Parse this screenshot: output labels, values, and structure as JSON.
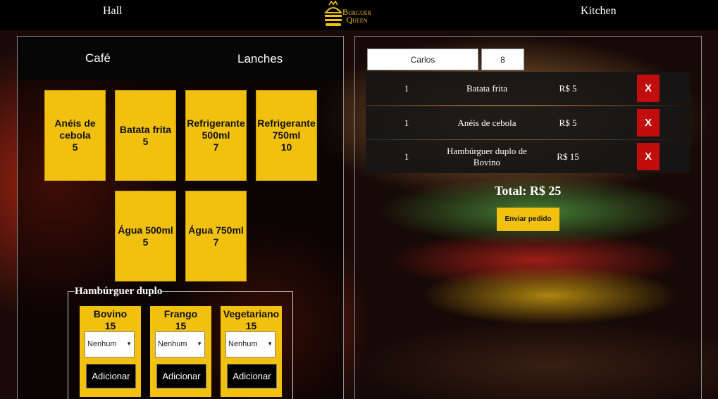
{
  "nav": {
    "hall": "Hall",
    "kitchen": "Kitchen"
  },
  "logo": {
    "line1": "Burguer",
    "line2": "Queen"
  },
  "tabs": [
    {
      "label": "Café"
    },
    {
      "label": "Lanches"
    }
  ],
  "products": [
    {
      "name": "Anéis de cebola",
      "price": "5"
    },
    {
      "name": "Batata frita",
      "price": "5"
    },
    {
      "name": "Refrigerante 500ml",
      "price": "7"
    },
    {
      "name": "Refrigerante 750ml",
      "price": "10"
    },
    {
      "name": "Água 500ml",
      "price": "5"
    },
    {
      "name": "Água 750ml",
      "price": "7"
    }
  ],
  "burger": {
    "legend": "Hambúrguer duplo",
    "options": [
      {
        "name": "Bovino",
        "price": "15",
        "extra": "Nenhum",
        "add_label": "Adicionar"
      },
      {
        "name": "Frango",
        "price": "15",
        "extra": "Nenhum",
        "add_label": "Adicionar"
      },
      {
        "name": "Vegetariano",
        "price": "15",
        "extra": "Nenhum",
        "add_label": "Adicionar"
      }
    ]
  },
  "order": {
    "client_name": "Carlos",
    "table_number": "8",
    "items": [
      {
        "qty": "1",
        "name": "Batata frita",
        "price": "R$ 5",
        "remove_label": "X"
      },
      {
        "qty": "1",
        "name": "Anéis de cebola",
        "price": "R$ 5",
        "remove_label": "X"
      },
      {
        "qty": "1",
        "name": "Hambúrguer duplo de Bovino",
        "price": "R$ 15",
        "remove_label": "X"
      }
    ],
    "total": "Total: R$ 25",
    "send_label": "Enviar pedido"
  },
  "colors": {
    "accent": "#f2c10f",
    "danger": "#c20d0d",
    "bar": "#000000"
  },
  "icons": {
    "logo": "burger-icon",
    "dropdown": "chevron-down-icon"
  }
}
